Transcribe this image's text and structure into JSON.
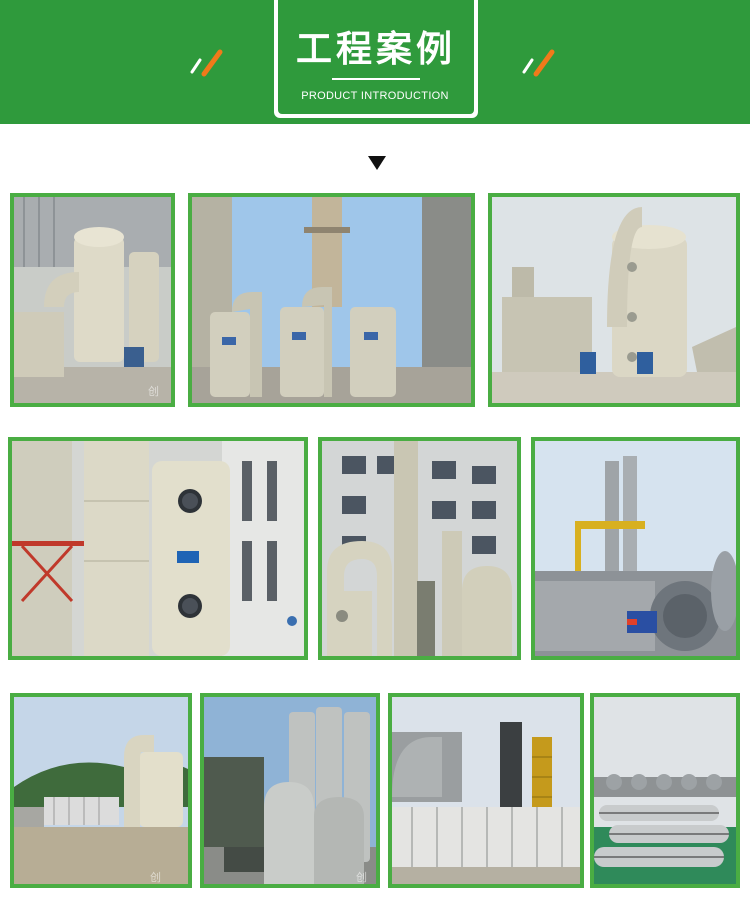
{
  "header": {
    "title": "工程案例",
    "subtitle": "PRODUCT INTRODUCTION",
    "decor_icon": "diagonal-slash-icon",
    "arrow_icon": "triangle-down-icon"
  },
  "colors": {
    "banner_green": "#2f9a3c",
    "frame_green": "#4aad43",
    "accent_orange": "#f07a1a",
    "equipment_beige": "#d9d6c3"
  },
  "gallery": {
    "rows": [
      {
        "photos": [
          "scrubber-tower-indoor",
          "scrubber-towers-with-chimney",
          "scrubber-tower-outdoor-plant"
        ]
      },
      {
        "photos": [
          "scrubber-tower-closeup",
          "scrubber-towers-by-building",
          "exhaust-stacks-and-fans"
        ]
      },
      {
        "photos": [
          "scrubber-hillside-site",
          "scrubber-rooftop-cluster",
          "scrubber-control-cabinets",
          "rooftop-duct-array"
        ]
      }
    ],
    "watermark": "创"
  }
}
